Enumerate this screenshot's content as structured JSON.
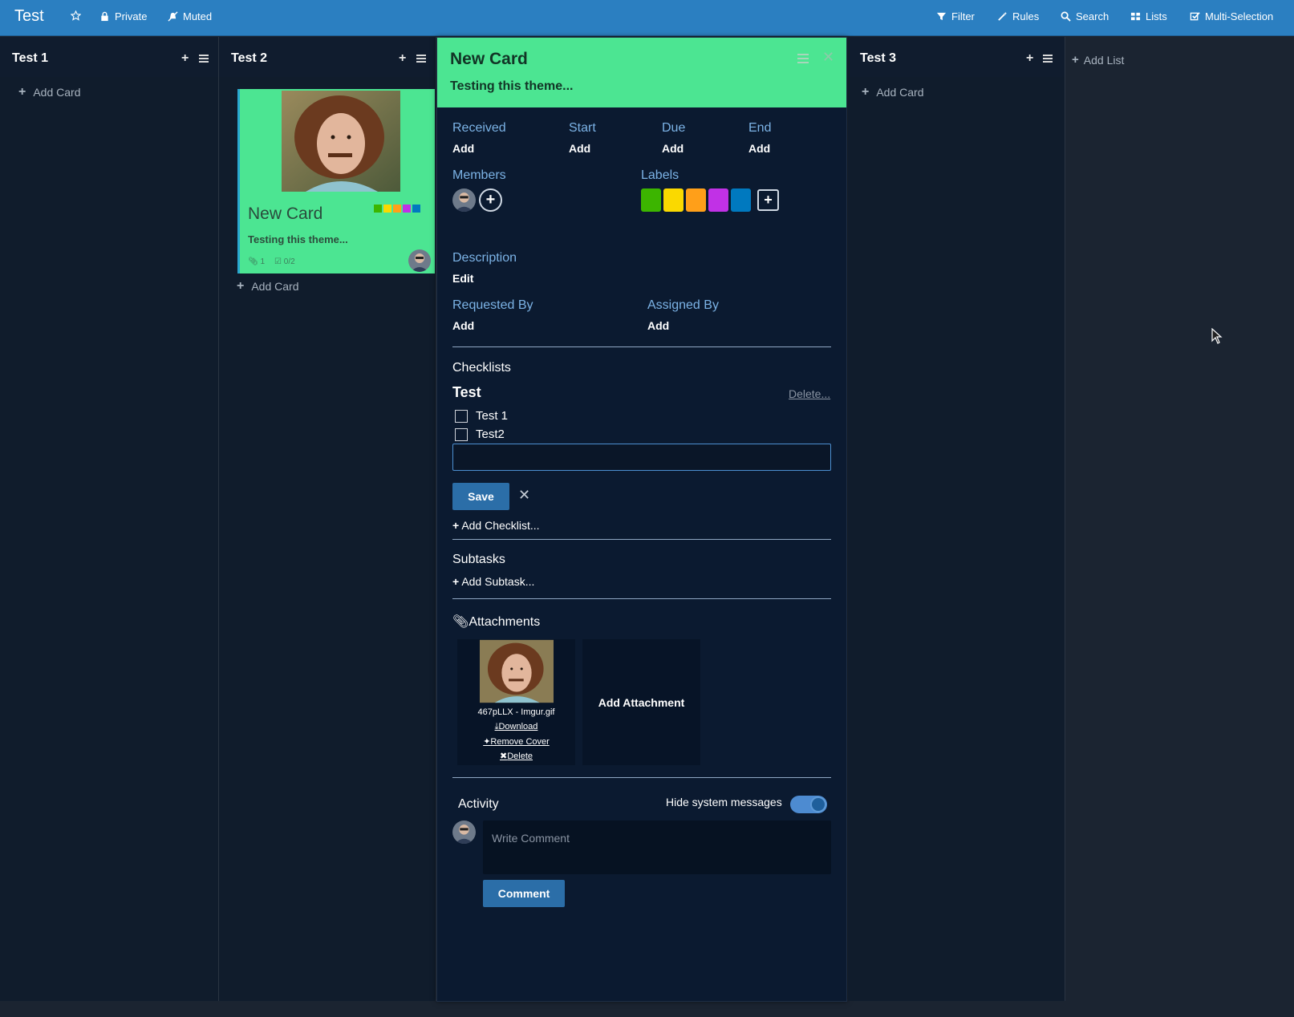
{
  "header": {
    "board_title": "Test",
    "private_label": "Private",
    "muted_label": "Muted",
    "filter_label": "Filter",
    "rules_label": "Rules",
    "search_label": "Search",
    "lists_label": "Lists",
    "multi_selection_label": "Multi-Selection"
  },
  "lists": [
    {
      "title": "Test 1",
      "add_card_label": "Add Card"
    },
    {
      "title": "Test 2",
      "add_card_label": "Add Card"
    },
    {
      "title": "Test 3",
      "add_card_label": "Add Card"
    }
  ],
  "add_list_label": "Add List",
  "minicard": {
    "title": "New Card",
    "description": "Testing this theme...",
    "attachments_count": "1",
    "checklist_progress": "0/2",
    "label_colors": [
      "#3cb500",
      "#fad900",
      "#ff9f19",
      "#c131e6",
      "#0079bf"
    ]
  },
  "card_details": {
    "title": "New Card",
    "subtitle": "Testing this theme...",
    "dates": [
      {
        "label": "Received",
        "value": "Add"
      },
      {
        "label": "Start",
        "value": "Add"
      },
      {
        "label": "Due",
        "value": "Add"
      },
      {
        "label": "End",
        "value": "Add"
      }
    ],
    "members_label": "Members",
    "labels_label": "Labels",
    "label_colors": [
      "#3cb500",
      "#fad900",
      "#ff9f19",
      "#c131e6",
      "#0079bf"
    ],
    "description_label": "Description",
    "description_action": "Edit",
    "requested_by_label": "Requested By",
    "requested_by_value": "Add",
    "assigned_by_label": "Assigned By",
    "assigned_by_value": "Add",
    "checklists_label": "Checklists",
    "checklist": {
      "title": "Test",
      "delete_label": "Delete...",
      "items": [
        {
          "text": "Test 1",
          "checked": false
        },
        {
          "text": "Test2",
          "checked": false
        }
      ],
      "new_item_value": "",
      "save_label": "Save"
    },
    "add_checklist_label": "Add Checklist...",
    "subtasks_label": "Subtasks",
    "add_subtask_label": "Add Subtask...",
    "attachments_label": "Attachments",
    "attachment": {
      "name": "467pLLX - Imgur.gif",
      "download_label": "Download",
      "remove_cover_label": "Remove Cover",
      "delete_label": "Delete"
    },
    "add_attachment_label": "Add Attachment",
    "activity_label": "Activity",
    "hide_system_messages_label": "Hide system messages",
    "hide_system_messages_on": true,
    "comment_placeholder": "Write Comment",
    "comment_button_label": "Comment"
  },
  "colors": {
    "header_bg": "#2b7fc1",
    "card_accent": "#4ce592",
    "panel_bg": "#0b1a30",
    "button_blue": "#2b6ea8"
  }
}
